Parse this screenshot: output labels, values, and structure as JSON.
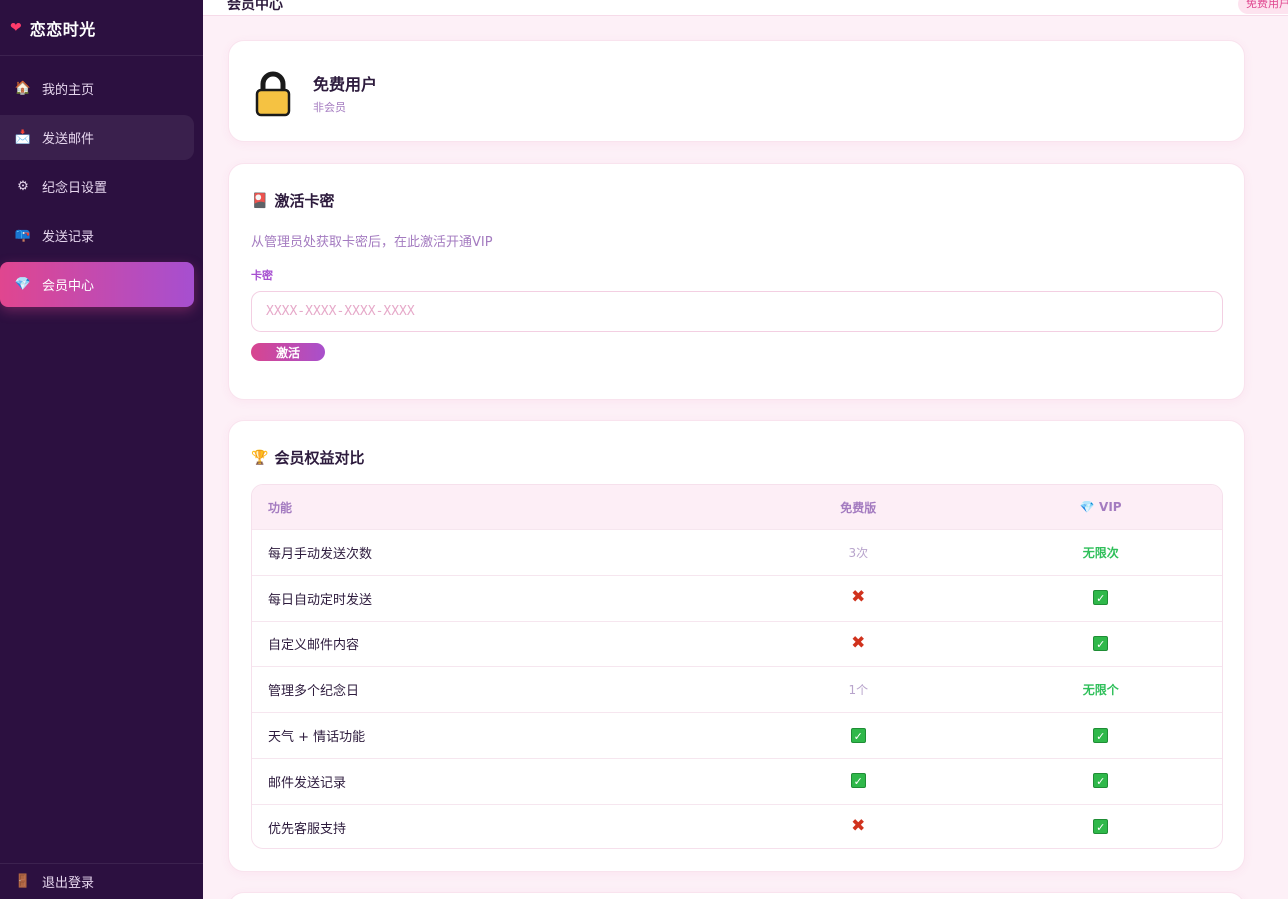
{
  "brand": {
    "icon": "heart-icon",
    "name": "恋恋时光"
  },
  "sidebar": {
    "items": [
      {
        "label": "我的主页",
        "icon": "home-icon"
      },
      {
        "label": "发送邮件",
        "icon": "mail-icon"
      },
      {
        "label": "纪念日设置",
        "icon": "gear-icon"
      },
      {
        "label": "发送记录",
        "icon": "mailbox-icon"
      },
      {
        "label": "会员中心",
        "icon": "diamond-icon"
      }
    ],
    "active_index": 4,
    "logout_label": "退出登录"
  },
  "header": {
    "title": "会员中心",
    "badge": "免费用户"
  },
  "user": {
    "name": "免费用户",
    "status": "非会员",
    "icon": "lock-icon"
  },
  "activate": {
    "title": "激活卡密",
    "icon": "card-icon",
    "description": "从管理员处获取卡密后，在此激活开通VIP",
    "field_label": "卡密",
    "placeholder": "XXXX-XXXX-XXXX-XXXX",
    "value": "",
    "button_label": "激活"
  },
  "compare": {
    "title": "会员权益对比",
    "icon": "trophy-icon",
    "headers": {
      "feature": "功能",
      "free": "免费版",
      "vip": "VIP",
      "vip_icon": "diamond-icon"
    },
    "rows": [
      {
        "feature": "每月手动发送次数",
        "free": "3次",
        "vip": "无限次"
      },
      {
        "feature": "每日自动定时发送",
        "free": "cross",
        "vip": "check"
      },
      {
        "feature": "自定义邮件内容",
        "free": "cross",
        "vip": "check"
      },
      {
        "feature": "管理多个纪念日",
        "free": "1个",
        "vip": "无限个"
      },
      {
        "feature": "天气 + 情话功能",
        "free": "check",
        "vip": "check"
      },
      {
        "feature": "邮件发送记录",
        "free": "check",
        "vip": "check"
      },
      {
        "feature": "优先客服支持",
        "free": "cross",
        "vip": "check"
      }
    ]
  },
  "colors": {
    "sidebar_bg": "#2c1040",
    "accent": "#e0468f",
    "accent2": "#a64fd0",
    "success": "#2fbf5a",
    "danger": "#d0321d"
  }
}
